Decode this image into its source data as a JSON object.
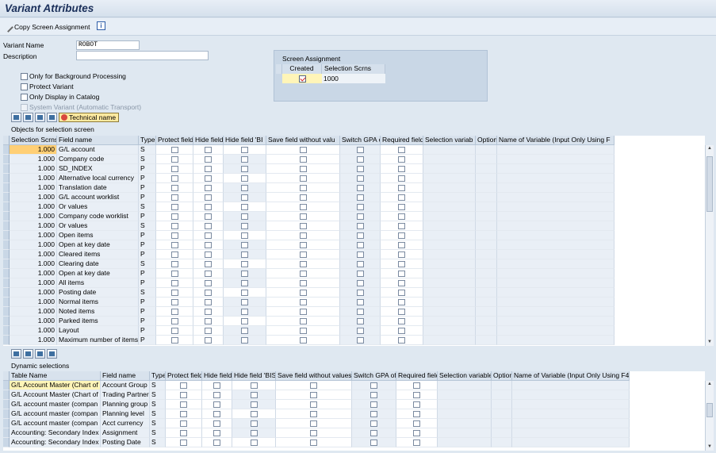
{
  "title": "Variant Attributes",
  "toolbar": {
    "copy_label": "Copy Screen Assignment"
  },
  "form": {
    "variant_name_label": "Variant Name",
    "variant_name_value": "ROBOT",
    "description_label": "Description",
    "description_value": "",
    "checkboxes": [
      "Only for Background Processing",
      "Protect Variant",
      "Only Display in Catalog",
      "System Variant (Automatic Transport)"
    ]
  },
  "screen_assignment": {
    "title": "Screen Assignment",
    "col_created": "Created",
    "col_selection": "Selection Scrns",
    "value": "1000"
  },
  "tools": {
    "technical_name": "Technical name"
  },
  "objects": {
    "title": "Objects for selection screen",
    "headers": [
      "Selection Scrns",
      "Field name",
      "Type",
      "Protect field",
      "Hide field",
      "Hide field 'BI",
      "Save field without valu",
      "Switch GPA o",
      "Required field",
      "Selection variab",
      "Option",
      "Name of Variable (Input Only Using F"
    ],
    "rows": [
      [
        "1.000",
        "G/L account",
        "S"
      ],
      [
        "1.000",
        "Company code",
        "S"
      ],
      [
        "1.000",
        "SD_INDEX",
        "P"
      ],
      [
        "1.000",
        "Alternative local currency",
        "P"
      ],
      [
        "1.000",
        "Translation date",
        "P"
      ],
      [
        "1.000",
        "G/L account worklist",
        "P"
      ],
      [
        "1.000",
        "Or values",
        "S"
      ],
      [
        "1.000",
        "Company code worklist",
        "P"
      ],
      [
        "1.000",
        "Or values",
        "S"
      ],
      [
        "1.000",
        "Open items",
        "P"
      ],
      [
        "1.000",
        "Open at key date",
        "P"
      ],
      [
        "1.000",
        "Cleared items",
        "P"
      ],
      [
        "1.000",
        "Clearing date",
        "S"
      ],
      [
        "1.000",
        "Open at key date",
        "P"
      ],
      [
        "1.000",
        "All items",
        "P"
      ],
      [
        "1.000",
        "Posting date",
        "S"
      ],
      [
        "1.000",
        "Normal items",
        "P"
      ],
      [
        "1.000",
        "Noted items",
        "P"
      ],
      [
        "1.000",
        "Parked items",
        "P"
      ],
      [
        "1.000",
        "Layout",
        "P"
      ],
      [
        "1.000",
        "Maximum number of items",
        "P"
      ]
    ]
  },
  "dynamic": {
    "title": "Dynamic selections",
    "headers": [
      "Table Name",
      "Field name",
      "Type",
      "Protect field",
      "Hide field",
      "Hide field 'BIS'",
      "Save field without values",
      "Switch GPA off",
      "Required field",
      "Selection variable",
      "Option",
      "Name of Variable (Input Only Using F4)"
    ],
    "rows": [
      [
        "G/L Account Master (Chart of",
        "Account Group",
        "S"
      ],
      [
        "G/L Account Master (Chart of",
        "Trading Partner",
        "S"
      ],
      [
        "G/L account master (compan",
        "Planning group",
        "S"
      ],
      [
        "G/L account master (compan",
        "Planning level",
        "S"
      ],
      [
        "G/L account master (compan",
        "Acct currency",
        "S"
      ],
      [
        "Accounting: Secondary Index",
        "Assignment",
        "S"
      ],
      [
        "Accounting: Secondary Index",
        "Posting Date",
        "S"
      ]
    ]
  }
}
